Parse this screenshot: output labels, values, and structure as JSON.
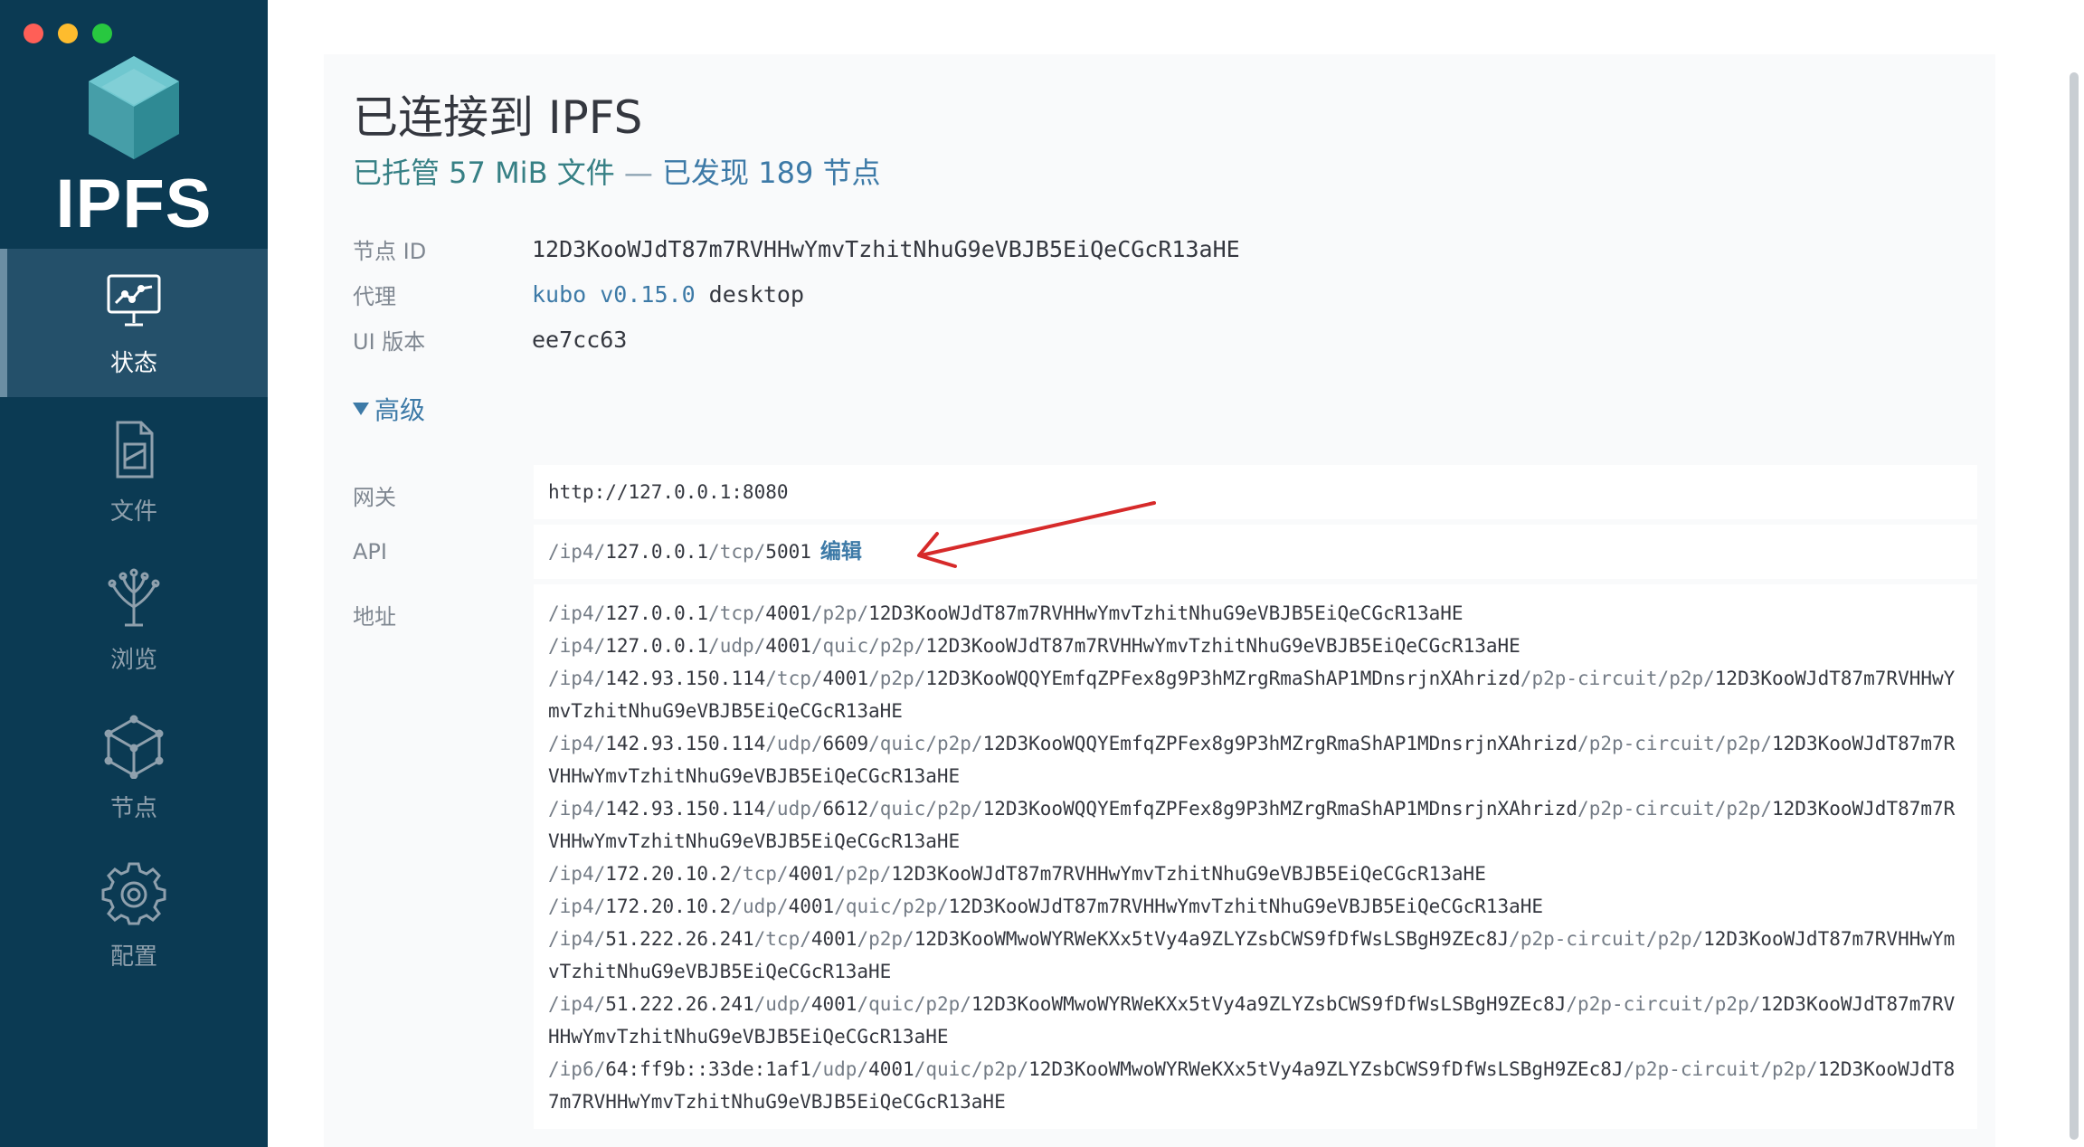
{
  "app": {
    "logo_text": "IPFS",
    "colors": {
      "sidebar": "#0b3a53",
      "accent": "#3d7aa7",
      "teal": "#378085",
      "annotation": "#d62a2a"
    }
  },
  "sidebar": {
    "items": [
      {
        "label": "状态",
        "icon": "status-icon",
        "active": true
      },
      {
        "label": "文件",
        "icon": "files-icon",
        "active": false
      },
      {
        "label": "浏览",
        "icon": "explore-icon",
        "active": false
      },
      {
        "label": "节点",
        "icon": "peers-icon",
        "active": false
      },
      {
        "label": "配置",
        "icon": "settings-icon",
        "active": false
      }
    ]
  },
  "status": {
    "title": "已连接到 IPFS",
    "subtitle_hosting": "已托管 57 MiB 文件",
    "subtitle_sep": " — ",
    "subtitle_peers": "已发现 189 节点",
    "info": {
      "node_id_label": "节点 ID",
      "node_id": "12D3KooWJdT87m7RVHHwYmvTzhitNhuG9eVBJB5EiQeCGcR13aHE",
      "agent_label": "代理",
      "agent_link": "kubo v0.15.0",
      "agent_rest": " desktop",
      "ui_version_label": "UI 版本",
      "ui_version": "ee7cc63"
    },
    "advanced_label": "高级",
    "gateway_label": "网关",
    "gateway": "http://127.0.0.1:8080",
    "api_label": "API",
    "api_value": "/ip4/127.0.0.1/tcp/5001",
    "api_edit": "编辑",
    "addresses_label": "地址",
    "addresses": [
      "/ip4/127.0.0.1/tcp/4001/p2p/12D3KooWJdT87m7RVHHwYmvTzhitNhuG9eVBJB5EiQeCGcR13aHE",
      "/ip4/127.0.0.1/udp/4001/quic/p2p/12D3KooWJdT87m7RVHHwYmvTzhitNhuG9eVBJB5EiQeCGcR13aHE",
      "/ip4/142.93.150.114/tcp/4001/p2p/12D3KooWQQYEmfqZPFex8g9P3hMZrgRmaShAP1MDnsrjnXAhrizd/p2p-circuit/p2p/12D3KooWJdT87m7RVHHwYmvTzhitNhuG9eVBJB5EiQeCGcR13aHE",
      "/ip4/142.93.150.114/udp/6609/quic/p2p/12D3KooWQQYEmfqZPFex8g9P3hMZrgRmaShAP1MDnsrjnXAhrizd/p2p-circuit/p2p/12D3KooWJdT87m7RVHHwYmvTzhitNhuG9eVBJB5EiQeCGcR13aHE",
      "/ip4/142.93.150.114/udp/6612/quic/p2p/12D3KooWQQYEmfqZPFex8g9P3hMZrgRmaShAP1MDnsrjnXAhrizd/p2p-circuit/p2p/12D3KooWJdT87m7RVHHwYmvTzhitNhuG9eVBJB5EiQeCGcR13aHE",
      "/ip4/172.20.10.2/tcp/4001/p2p/12D3KooWJdT87m7RVHHwYmvTzhitNhuG9eVBJB5EiQeCGcR13aHE",
      "/ip4/172.20.10.2/udp/4001/quic/p2p/12D3KooWJdT87m7RVHHwYmvTzhitNhuG9eVBJB5EiQeCGcR13aHE",
      "/ip4/51.222.26.241/tcp/4001/p2p/12D3KooWMwoWYRWeKXx5tVy4a9ZLYZsbCWS9fDfWsLSBgH9ZEc8J/p2p-circuit/p2p/12D3KooWJdT87m7RVHHwYmvTzhitNhuG9eVBJB5EiQeCGcR13aHE",
      "/ip4/51.222.26.241/udp/4001/quic/p2p/12D3KooWMwoWYRWeKXx5tVy4a9ZLYZsbCWS9fDfWsLSBgH9ZEc8J/p2p-circuit/p2p/12D3KooWJdT87m7RVHHwYmvTzhitNhuG9eVBJB5EiQeCGcR13aHE",
      "/ip6/64:ff9b::33de:1af1/udp/4001/quic/p2p/12D3KooWMwoWYRWeKXx5tVy4a9ZLYZsbCWS9fDfWsLSBgH9ZEc8J/p2p-circuit/p2p/12D3KooWJdT87m7RVHHwYmvTzhitNhuG9eVBJB5EiQeCGcR13aHE"
    ]
  }
}
